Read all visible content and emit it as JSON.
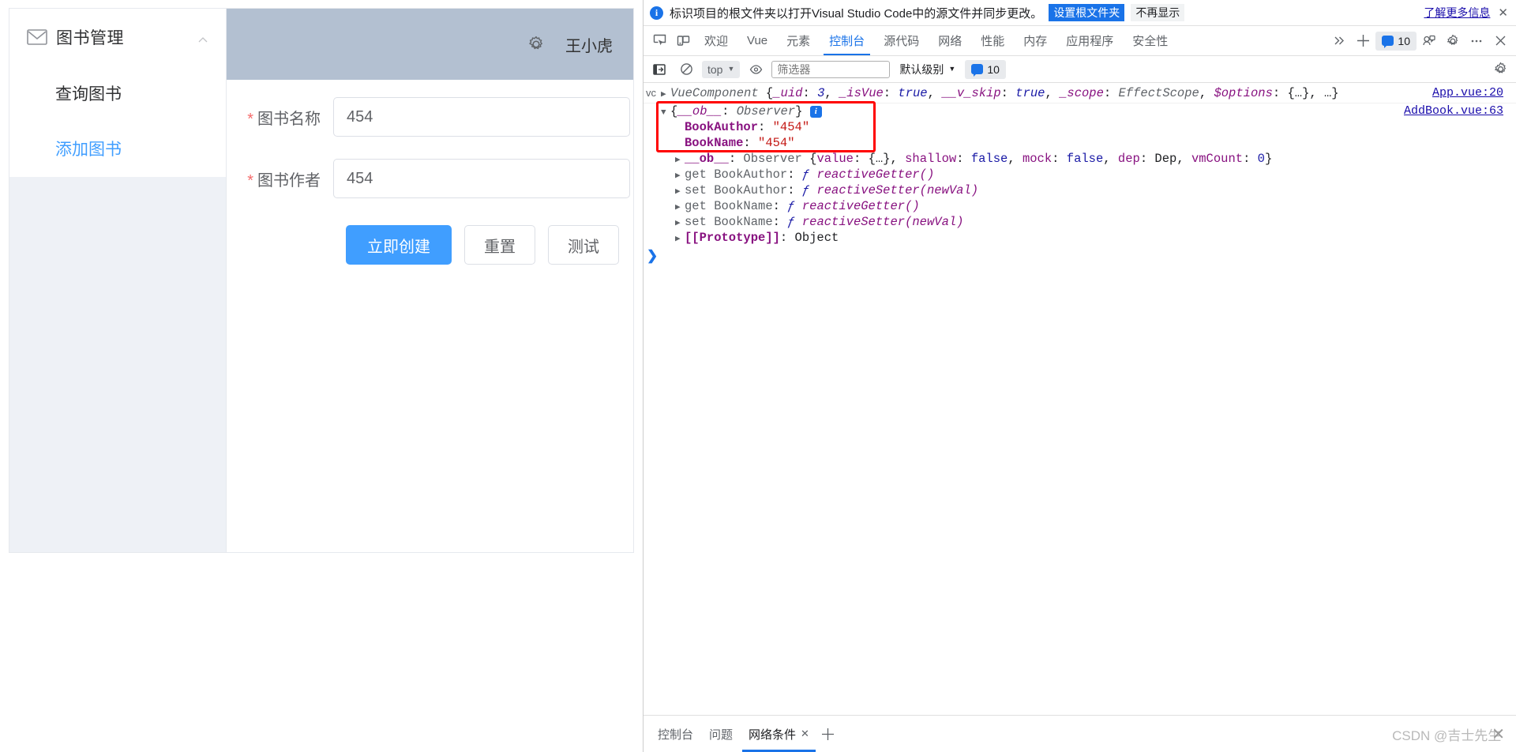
{
  "webapp": {
    "sidebar": {
      "group_title": "图书管理",
      "group_icon": "envelope-icon",
      "collapse_icon": "chevron-up-icon",
      "items": [
        {
          "label": "查询图书",
          "active": false
        },
        {
          "label": "添加图书",
          "active": true
        }
      ]
    },
    "header": {
      "gear_icon": "gear-icon",
      "username": "王小虎"
    },
    "form": {
      "fields": [
        {
          "required_mark": "*",
          "label": "图书名称",
          "value": "454",
          "placeholder": ""
        },
        {
          "required_mark": "*",
          "label": "图书作者",
          "value": "454",
          "placeholder": ""
        }
      ],
      "buttons": [
        {
          "label": "立即创建",
          "style": "primary"
        },
        {
          "label": "重置",
          "style": "default"
        },
        {
          "label": "测试",
          "style": "default"
        }
      ]
    },
    "colors": {
      "header_bg": "#b3c0d1",
      "primary": "#409eff",
      "required": "#f56c6c",
      "sidebar_filler": "#eef1f6"
    }
  },
  "devtools": {
    "notification": {
      "icon": "info-circle-icon",
      "message": "标识项目的根文件夹以打开Visual Studio Code中的源文件并同步更改。",
      "primary_button": "设置根文件夹",
      "secondary_button": "不再显示",
      "learn_more": "了解更多信息",
      "close_icon": "close-icon"
    },
    "tabbar": {
      "left_icons": [
        "inspect-element-icon",
        "device-toolbar-icon"
      ],
      "tabs": [
        {
          "label": "欢迎",
          "active": false
        },
        {
          "label": "Vue",
          "active": false
        },
        {
          "label": "元素",
          "active": false
        },
        {
          "label": "控制台",
          "active": true
        },
        {
          "label": "源代码",
          "active": false
        },
        {
          "label": "网络",
          "active": false
        },
        {
          "label": "性能",
          "active": false
        },
        {
          "label": "内存",
          "active": false
        },
        {
          "label": "应用程序",
          "active": false
        },
        {
          "label": "安全性",
          "active": false
        }
      ],
      "overflow_icon": "chevrons-right-icon",
      "add_icon": "plus-icon",
      "issues_count": "10",
      "issues_icon": "message-badge-icon",
      "right_icons": [
        "devices-icon",
        "settings-gear-icon",
        "more-options-icon",
        "close-devtools-icon"
      ]
    },
    "console_toolbar": {
      "sidebar_icon": "console-sidebar-icon",
      "clear_icon": "clear-console-icon",
      "context": "top",
      "context_caret": "chevron-down-icon",
      "eye_icon": "live-expression-icon",
      "filter_placeholder": "筛选器",
      "filter_value": "",
      "level": "默认级别",
      "level_caret": "chevron-down-icon",
      "issues_count": "10",
      "settings_icon": "settings-gear-icon"
    },
    "console": {
      "rows": [
        {
          "kind": "header",
          "lead": "vc",
          "arrow": "▶",
          "text_parts": [
            {
              "t": "VueComponent ",
              "c": "k-grey i-italic"
            },
            {
              "t": "{",
              "c": "k-dark"
            },
            {
              "t": "_uid",
              "c": "k-purple i-italic"
            },
            {
              "t": ": ",
              "c": "k-dark"
            },
            {
              "t": "3",
              "c": "k-blue i-italic"
            },
            {
              "t": ", ",
              "c": "k-dark"
            },
            {
              "t": "_isVue",
              "c": "k-purple i-italic"
            },
            {
              "t": ": ",
              "c": "k-dark"
            },
            {
              "t": "true",
              "c": "k-blue i-italic"
            },
            {
              "t": ", ",
              "c": "k-dark"
            },
            {
              "t": "__v_skip",
              "c": "k-purple i-italic"
            },
            {
              "t": ": ",
              "c": "k-dark"
            },
            {
              "t": "true",
              "c": "k-blue i-italic"
            },
            {
              "t": ", ",
              "c": "k-dark"
            },
            {
              "t": "_scope",
              "c": "k-purple i-italic"
            },
            {
              "t": ": ",
              "c": "k-dark"
            },
            {
              "t": "EffectScope",
              "c": "k-grey i-italic"
            },
            {
              "t": ", ",
              "c": "k-dark"
            },
            {
              "t": "$options",
              "c": "k-purple i-italic"
            },
            {
              "t": ": ",
              "c": "k-dark"
            },
            {
              "t": "{…}",
              "c": "k-dark"
            },
            {
              "t": ", …}",
              "c": "k-dark"
            }
          ],
          "source": "App.vue:20"
        },
        {
          "kind": "obj",
          "indent": 0,
          "arrow": "▼",
          "text_parts": [
            {
              "t": "{",
              "c": "k-dark"
            },
            {
              "t": "__ob__",
              "c": "k-purple i-italic"
            },
            {
              "t": ": ",
              "c": "k-dark"
            },
            {
              "t": "Observer",
              "c": "k-grey i-italic"
            },
            {
              "t": "} ",
              "c": "k-dark"
            }
          ],
          "has_info_badge": true,
          "source": "AddBook.vue:63"
        },
        {
          "kind": "prop",
          "indent": 1,
          "arrow": "",
          "text_parts": [
            {
              "t": "BookAuthor",
              "c": "k-mag"
            },
            {
              "t": ": ",
              "c": "k-dark"
            },
            {
              "t": "\"454\"",
              "c": "k-str"
            }
          ]
        },
        {
          "kind": "prop",
          "indent": 1,
          "arrow": "",
          "text_parts": [
            {
              "t": "BookName",
              "c": "k-mag"
            },
            {
              "t": ": ",
              "c": "k-dark"
            },
            {
              "t": "\"454\"",
              "c": "k-str"
            }
          ]
        },
        {
          "kind": "prop",
          "indent": 1,
          "arrow": "▶",
          "text_parts": [
            {
              "t": "__ob__",
              "c": "k-mag"
            },
            {
              "t": ": ",
              "c": "k-dark"
            },
            {
              "t": "Observer ",
              "c": "k-grey"
            },
            {
              "t": "{",
              "c": "k-dark"
            },
            {
              "t": "value",
              "c": "k-purple"
            },
            {
              "t": ": ",
              "c": "k-dark"
            },
            {
              "t": "{…}",
              "c": "k-dark"
            },
            {
              "t": ", ",
              "c": "k-dark"
            },
            {
              "t": "shallow",
              "c": "k-purple"
            },
            {
              "t": ": ",
              "c": "k-dark"
            },
            {
              "t": "false",
              "c": "k-blue"
            },
            {
              "t": ", ",
              "c": "k-dark"
            },
            {
              "t": "mock",
              "c": "k-purple"
            },
            {
              "t": ": ",
              "c": "k-dark"
            },
            {
              "t": "false",
              "c": "k-blue"
            },
            {
              "t": ", ",
              "c": "k-dark"
            },
            {
              "t": "dep",
              "c": "k-purple"
            },
            {
              "t": ": ",
              "c": "k-dark"
            },
            {
              "t": "Dep",
              "c": "k-dark"
            },
            {
              "t": ", ",
              "c": "k-dark"
            },
            {
              "t": "vmCount",
              "c": "k-purple"
            },
            {
              "t": ": ",
              "c": "k-dark"
            },
            {
              "t": "0",
              "c": "k-blue"
            },
            {
              "t": "}",
              "c": "k-dark"
            }
          ]
        },
        {
          "kind": "prop",
          "indent": 1,
          "arrow": "▶",
          "text_parts": [
            {
              "t": "get BookAuthor",
              "c": "k-grey"
            },
            {
              "t": ": ",
              "c": "k-dark"
            },
            {
              "t": "ƒ ",
              "c": "k-blue i-italic"
            },
            {
              "t": "reactiveGetter()",
              "c": "k-fn"
            }
          ]
        },
        {
          "kind": "prop",
          "indent": 1,
          "arrow": "▶",
          "text_parts": [
            {
              "t": "set BookAuthor",
              "c": "k-grey"
            },
            {
              "t": ": ",
              "c": "k-dark"
            },
            {
              "t": "ƒ ",
              "c": "k-blue i-italic"
            },
            {
              "t": "reactiveSetter(newVal)",
              "c": "k-fn"
            }
          ]
        },
        {
          "kind": "prop",
          "indent": 1,
          "arrow": "▶",
          "text_parts": [
            {
              "t": "get BookName",
              "c": "k-grey"
            },
            {
              "t": ": ",
              "c": "k-dark"
            },
            {
              "t": "ƒ ",
              "c": "k-blue i-italic"
            },
            {
              "t": "reactiveGetter()",
              "c": "k-fn"
            }
          ]
        },
        {
          "kind": "prop",
          "indent": 1,
          "arrow": "▶",
          "text_parts": [
            {
              "t": "set BookName",
              "c": "k-grey"
            },
            {
              "t": ": ",
              "c": "k-dark"
            },
            {
              "t": "ƒ ",
              "c": "k-blue i-italic"
            },
            {
              "t": "reactiveSetter(newVal)",
              "c": "k-fn"
            }
          ]
        },
        {
          "kind": "prop",
          "indent": 1,
          "arrow": "▶",
          "text_parts": [
            {
              "t": "[[Prototype]]",
              "c": "k-mag"
            },
            {
              "t": ": ",
              "c": "k-dark"
            },
            {
              "t": "Object",
              "c": "k-dark"
            }
          ]
        }
      ],
      "prompt_caret": "❯"
    },
    "annotation": {
      "type": "red-rectangle",
      "highlights": [
        "{__ob__: Observer}",
        "BookAuthor: \"454\"",
        "BookName: \"454\""
      ],
      "color": "#ff0000"
    },
    "drawer": {
      "tabs": [
        {
          "label": "控制台",
          "active": false,
          "closable": false
        },
        {
          "label": "问题",
          "active": false,
          "closable": false
        },
        {
          "label": "网络条件",
          "active": true,
          "closable": true,
          "close_icon": "close-icon"
        }
      ],
      "add_icon": "plus-icon"
    }
  },
  "watermark": {
    "text": "CSDN @吉士先生"
  }
}
